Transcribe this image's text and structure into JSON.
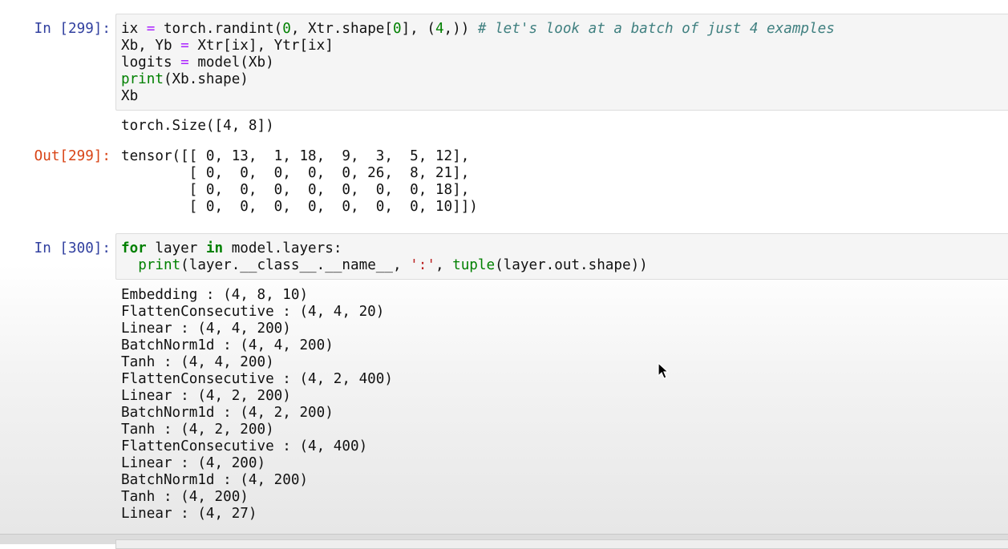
{
  "cells": [
    {
      "in_prompt": "In [299]:",
      "code": {
        "l1a": "ix ",
        "l1b": "=",
        "l1c": " torch.randint(",
        "l1d": "0",
        "l1e": ", Xtr.shape[",
        "l1f": "0",
        "l1g": "], (",
        "l1h": "4",
        "l1i": ",)) ",
        "l1comment": "# let's look at a batch of just 4 examples",
        "l2a": "Xb, Yb ",
        "l2b": "=",
        "l2c": " Xtr[ix], Ytr[ix]",
        "l3a": "logits ",
        "l3b": "=",
        "l3c": " model(Xb)",
        "l4a": "print",
        "l4b": "(Xb.shape)",
        "l5": "Xb"
      },
      "stdout": "torch.Size([4, 8])",
      "out_prompt": "Out[299]:",
      "result": [
        "tensor([[ 0, 13,  1, 18,  9,  3,  5, 12],",
        "        [ 0,  0,  0,  0,  0, 26,  8, 21],",
        "        [ 0,  0,  0,  0,  0,  0,  0, 18],",
        "        [ 0,  0,  0,  0,  0,  0,  0, 10]])"
      ]
    },
    {
      "in_prompt": "In [300]:",
      "code": {
        "l1a": "for",
        "l1b": " layer ",
        "l1c": "in",
        "l1d": " model.layers:",
        "l2indent": "  ",
        "l2a": "print",
        "l2b": "(layer.__class__.__name__, ",
        "l2c": "':'",
        "l2d": ", ",
        "l2e": "tuple",
        "l2f": "(layer.out.shape))"
      },
      "stdout_lines": [
        "Embedding : (4, 8, 10)",
        "FlattenConsecutive : (4, 4, 20)",
        "Linear : (4, 4, 200)",
        "BatchNorm1d : (4, 4, 200)",
        "Tanh : (4, 4, 200)",
        "FlattenConsecutive : (4, 2, 400)",
        "Linear : (4, 2, 200)",
        "BatchNorm1d : (4, 2, 200)",
        "Tanh : (4, 2, 200)",
        "FlattenConsecutive : (4, 400)",
        "Linear : (4, 200)",
        "BatchNorm1d : (4, 200)",
        "Tanh : (4, 200)",
        "Linear : (4, 27)"
      ]
    }
  ],
  "icons": {
    "pointer": "mouse-pointer-icon"
  },
  "colors": {
    "in_prompt": "#303f9f",
    "out_prompt": "#d84315",
    "keyword": "#008000",
    "operator": "#aa22ff",
    "comment": "#408080",
    "string": "#ba2121"
  }
}
